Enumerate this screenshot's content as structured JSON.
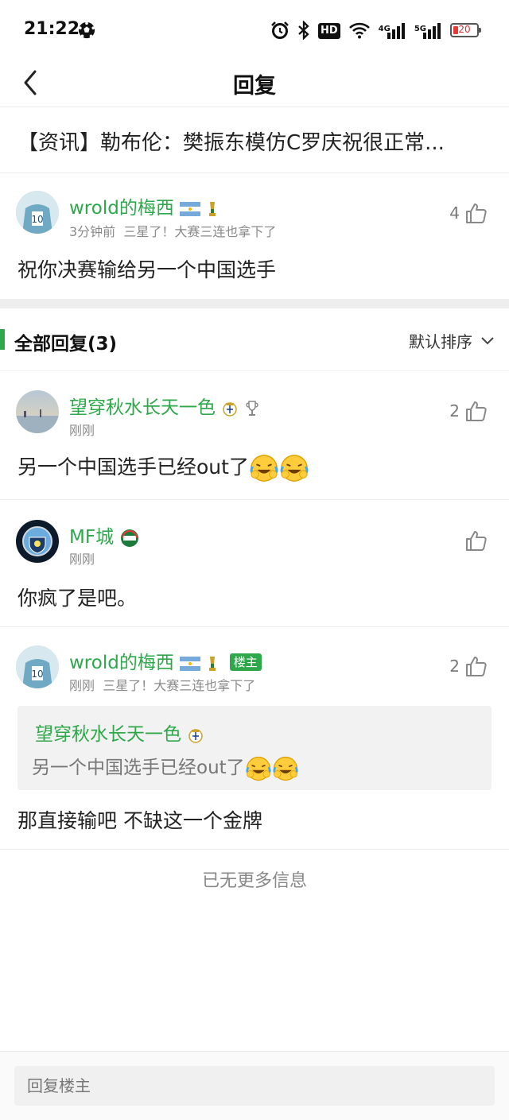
{
  "status_bar": {
    "time": "21:22",
    "hd_label": "HD",
    "network_4g": "4G",
    "network_5g": "5G",
    "battery_level": "20"
  },
  "header": {
    "title": "回复"
  },
  "news": {
    "text": "【资讯】勒布伦：樊振东模仿C罗庆祝很正常..."
  },
  "original_post": {
    "username": "wrold的梅西",
    "time": "3分钟前",
    "signature": "三星了！大赛三连也拿下了",
    "likes": "4",
    "content": "祝你决赛输给另一个中国选手"
  },
  "section": {
    "title": "全部回复(3)",
    "sort_label": "默认排序"
  },
  "replies": [
    {
      "username": "望穿秋水长天一色",
      "time": "刚刚",
      "likes": "2",
      "content": "另一个中国选手已经out了"
    },
    {
      "username": "MF城",
      "time": "刚刚",
      "likes": "",
      "content": "你疯了是吧。"
    },
    {
      "username": "wrold的梅西",
      "owner_badge": "楼主",
      "time": "刚刚",
      "signature": "三星了！大赛三连也拿下了",
      "likes": "2",
      "quote_user": "望穿秋水长天一色",
      "quote_text": "另一个中国选手已经out了",
      "content": "那直接输吧 不缺这一个金牌"
    }
  ],
  "footer_note": "已无更多信息",
  "reply_input": {
    "placeholder": "回复楼主"
  },
  "colors": {
    "accent": "#2ea84a",
    "battery_low": "#e53935"
  },
  "icons": [
    "soccer-ball-icon",
    "alarm-icon",
    "bluetooth-icon",
    "wifi-icon",
    "signal-icon",
    "battery-icon",
    "back-arrow-icon",
    "thumbs-up-icon",
    "chevron-down-icon",
    "argentina-flag-icon",
    "world-cup-trophy-icon",
    "real-madrid-badge-icon",
    "champions-trophy-icon",
    "club-badge-icon",
    "laughing-crying-emoji-icon"
  ]
}
